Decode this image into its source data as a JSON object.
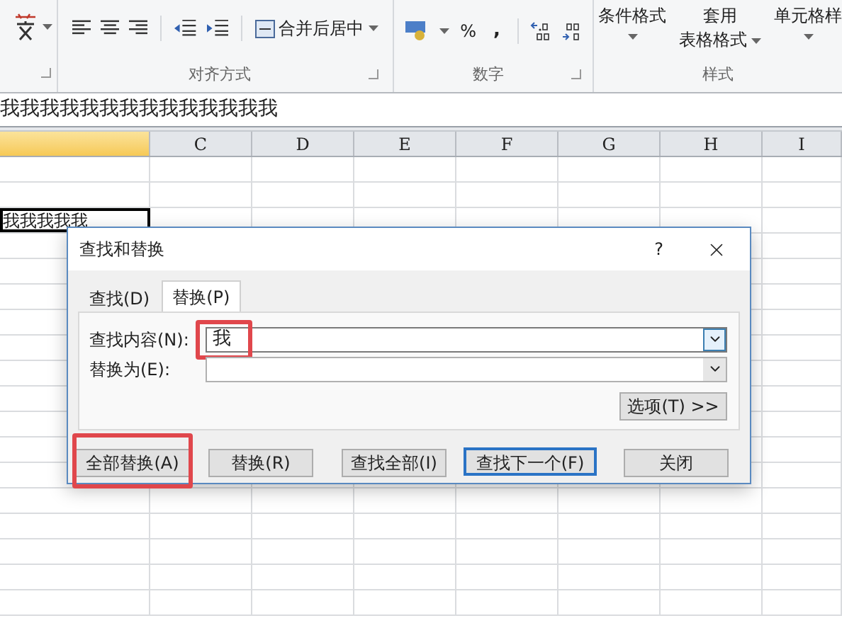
{
  "ribbon": {
    "alignment_group": {
      "label": "对齐方式",
      "merge_button": "合并后居中"
    },
    "number_group": {
      "label": "数字",
      "percent": "%",
      "comma": ","
    },
    "styles_group": {
      "label": "样式",
      "buttons": [
        {
          "lines": [
            "条件格式"
          ]
        },
        {
          "lines": [
            "套用",
            "表格格式"
          ]
        },
        {
          "lines": [
            "单元格样"
          ]
        }
      ]
    }
  },
  "formula_bar": {
    "value": "我我我我我我我我我我我我我我"
  },
  "columns": [
    {
      "selected": true
    },
    {
      "label": "C",
      "selected": false
    },
    {
      "label": "D",
      "selected": false
    },
    {
      "label": "E",
      "selected": false
    },
    {
      "label": "F",
      "selected": false
    },
    {
      "label": "G",
      "selected": false
    },
    {
      "label": "H",
      "selected": false
    },
    {
      "label": "I",
      "selected": false
    }
  ],
  "active_cell": {
    "value": "我我我我我"
  },
  "dialog": {
    "title": "查找和替换",
    "help": "?",
    "tabs": [
      {
        "label": "查找(D)",
        "selected": false
      },
      {
        "label": "替换(P)",
        "selected": true
      }
    ],
    "fields": [
      {
        "label": "查找内容(N):",
        "value": "我",
        "focused": true,
        "highlighted": true
      },
      {
        "label": "替换为(E):",
        "focused": false,
        "highlighted": false
      }
    ],
    "options_button": "选项(T) >>",
    "buttons": [
      {
        "label": "全部替换(A)",
        "default": false,
        "highlighted": true
      },
      {
        "label": "替换(R)",
        "default": false,
        "highlighted": false
      },
      {
        "label": "查找全部(I)",
        "default": false,
        "highlighted": false
      },
      {
        "label": "查找下一个(F)",
        "default": true,
        "highlighted": false
      },
      {
        "label": "关闭",
        "default": false,
        "highlighted": false
      }
    ]
  }
}
